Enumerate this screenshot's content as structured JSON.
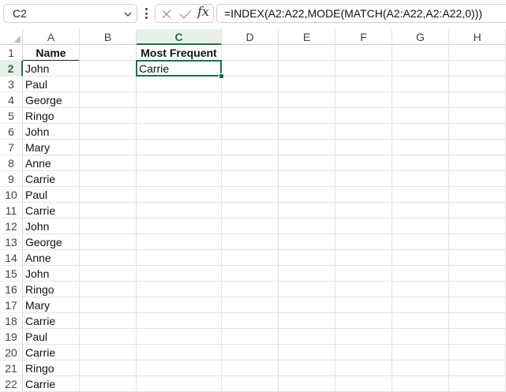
{
  "name_box": {
    "value": "C2"
  },
  "formula_bar": {
    "fx_label": "fx",
    "formula": "=INDEX(A2:A22,MODE(MATCH(A2:A22,A2:A22,0)))"
  },
  "columns": [
    "A",
    "B",
    "C",
    "D",
    "E",
    "F",
    "G",
    "H"
  ],
  "active_cell": {
    "column": "C",
    "row": 2
  },
  "rows": [
    {
      "num": "1",
      "A": "Name",
      "C": "Most Frequent"
    },
    {
      "num": "2",
      "A": "John",
      "C": "Carrie"
    },
    {
      "num": "3",
      "A": "Paul"
    },
    {
      "num": "4",
      "A": "George"
    },
    {
      "num": "5",
      "A": "Ringo"
    },
    {
      "num": "6",
      "A": "John"
    },
    {
      "num": "7",
      "A": "Mary"
    },
    {
      "num": "8",
      "A": "Anne"
    },
    {
      "num": "9",
      "A": "Carrie"
    },
    {
      "num": "10",
      "A": "Paul"
    },
    {
      "num": "11",
      "A": "Carrie"
    },
    {
      "num": "12",
      "A": "John"
    },
    {
      "num": "13",
      "A": "George"
    },
    {
      "num": "14",
      "A": "Anne"
    },
    {
      "num": "15",
      "A": "John"
    },
    {
      "num": "16",
      "A": "Ringo"
    },
    {
      "num": "17",
      "A": "Mary"
    },
    {
      "num": "18",
      "A": "Carrie"
    },
    {
      "num": "19",
      "A": "Paul"
    },
    {
      "num": "20",
      "A": "Carrie"
    },
    {
      "num": "21",
      "A": "Ringo"
    },
    {
      "num": "22",
      "A": "Carrie"
    }
  ]
}
